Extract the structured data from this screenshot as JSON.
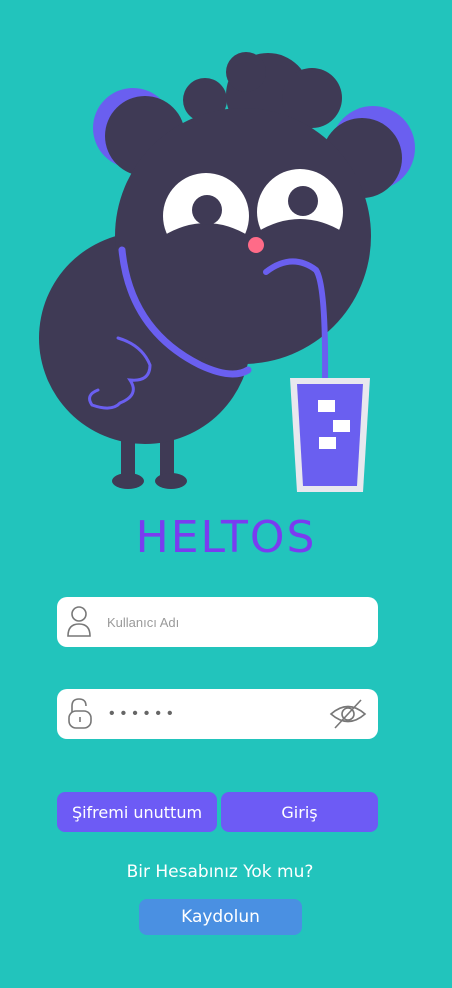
{
  "app": {
    "title": "HELTOS"
  },
  "login": {
    "username_placeholder": "Kullanıcı Adı",
    "password_value": "••••••"
  },
  "buttons": {
    "forgot_label": "Şifremi unuttum",
    "login_label": "Giriş"
  },
  "signup": {
    "question": "Bir Hesabınız Yok mu?",
    "register_label": "Kaydolun"
  },
  "icons": {
    "username": "user-icon",
    "password": "unlock-icon",
    "visibility": "eye-off-icon"
  },
  "colors": {
    "background": "#22c4bc",
    "title": "#7a3cf0",
    "primary_button": "#6d5bf5",
    "register_button": "#4a90e2",
    "mascot": "#3f3a55"
  }
}
